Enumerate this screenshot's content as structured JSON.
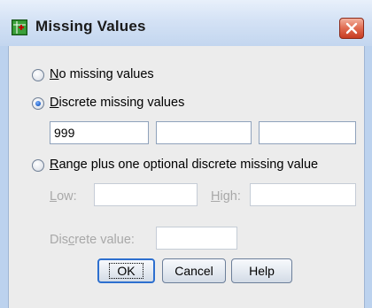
{
  "window": {
    "title": "Missing Values",
    "app_icon": "spss-app-icon",
    "close_icon": "close-icon"
  },
  "options": {
    "no_missing": {
      "label_pre": "",
      "mnemonic": "N",
      "label_post": "o missing values",
      "checked": false
    },
    "discrete": {
      "label_pre": "",
      "mnemonic": "D",
      "label_post": "iscrete missing values",
      "checked": true
    },
    "range": {
      "label_pre": "",
      "mnemonic": "R",
      "label_post": "ange plus one optional discrete missing value",
      "checked": false
    }
  },
  "discrete_values": [
    "999",
    "",
    ""
  ],
  "range": {
    "low_label_pre": "",
    "low_mnemonic": "L",
    "low_label_post": "ow:",
    "low_value": "",
    "high_label_pre": "",
    "high_mnemonic": "H",
    "high_label_post": "igh:",
    "high_value": "",
    "discrete_label_pre": "Dis",
    "discrete_mnemonic": "c",
    "discrete_label_post": "rete value:",
    "discrete_value": ""
  },
  "buttons": {
    "ok": "OK",
    "cancel": "Cancel",
    "help": "Help"
  },
  "colors": {
    "title_bar": "#c3d6ef",
    "close_button": "#e06a4f",
    "dialog_bg": "#ececec",
    "default_button_border": "#2d6fcf",
    "disabled_text": "#a8a8a8"
  }
}
